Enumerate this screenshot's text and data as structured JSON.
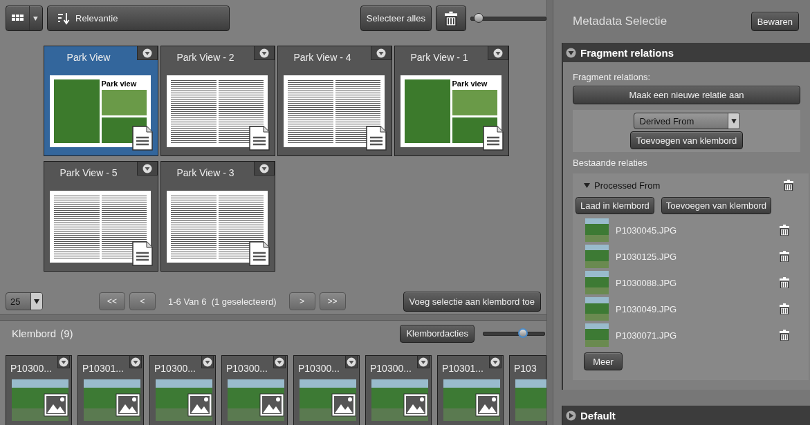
{
  "toolbar": {
    "sort_label": "Relevantie",
    "select_all": "Selecteer alles",
    "zoom": {
      "level": 0.1
    }
  },
  "documents": [
    {
      "title": "Park View",
      "selected": true,
      "kind": "cover",
      "preview_heading": "Park view"
    },
    {
      "title": "Park View - 2",
      "selected": false,
      "kind": "article"
    },
    {
      "title": "Park View - 4",
      "selected": false,
      "kind": "article"
    },
    {
      "title": "Park View - 1",
      "selected": false,
      "kind": "cover",
      "preview_heading": "Park view"
    },
    {
      "title": "Park View - 5",
      "selected": false,
      "kind": "article"
    },
    {
      "title": "Park View - 3",
      "selected": false,
      "kind": "article"
    }
  ],
  "pagination": {
    "page_size": "25",
    "first": "<<",
    "prev": "<",
    "status": "1-6 Van 6  (1 geselecteerd)",
    "next": ">",
    "last": ">>",
    "add_button": "Voeg selectie aan klembord toe"
  },
  "clipboard": {
    "title": "Klembord",
    "count": "(9)",
    "actions_button": "Klembordacties",
    "zoom": {
      "level": 0.65
    },
    "items": [
      {
        "name": "P10300..."
      },
      {
        "name": "P10301..."
      },
      {
        "name": "P10300..."
      },
      {
        "name": "P10300..."
      },
      {
        "name": "P10300..."
      },
      {
        "name": "P10300..."
      },
      {
        "name": "P10301..."
      },
      {
        "name": "P103"
      }
    ]
  },
  "metadata": {
    "title": "Metadata Selectie",
    "save_button": "Bewaren",
    "sections": [
      {
        "title": "Fragment relations",
        "expanded": true,
        "label": "Fragment relations:",
        "new_button": "Maak een nieuwe relatie aan",
        "relation_type": "Derived From",
        "add_button": "Toevoegen van klembord",
        "existing_label": "Bestaande relaties",
        "groups": [
          {
            "title": "Processed From",
            "expanded": true,
            "load_button": "Laad in klembord",
            "add_button": "Toevoegen van klembord",
            "files": [
              {
                "name": "P1030045.JPG"
              },
              {
                "name": "P1030125.JPG"
              },
              {
                "name": "P1030088.JPG"
              },
              {
                "name": "P1030049.JPG"
              },
              {
                "name": "P1030071.JPG"
              }
            ],
            "more_button": "Meer"
          }
        ]
      },
      {
        "title": "Default",
        "expanded": false
      }
    ]
  }
}
